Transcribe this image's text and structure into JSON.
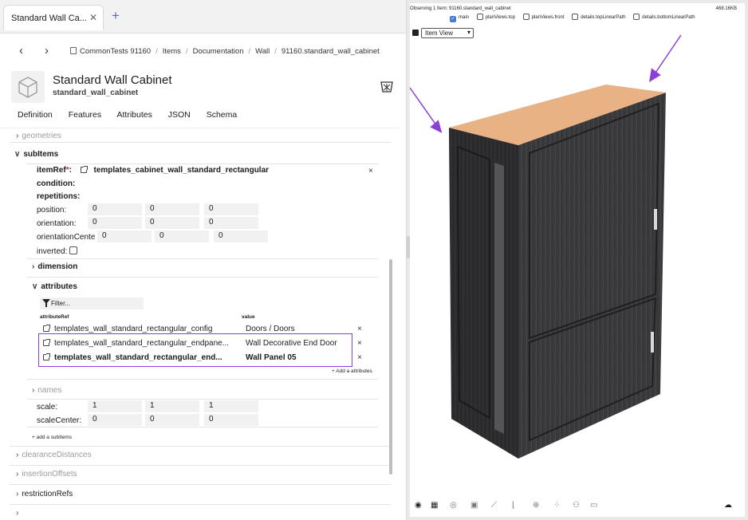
{
  "tab": {
    "title": "Standard Wall Ca...",
    "close": "✕",
    "add": "+"
  },
  "nav": {
    "back": "‹",
    "forward": "›"
  },
  "breadcrumb": [
    "CommonTests 91160",
    "Items",
    "Documentation",
    "Wall",
    "91160.standard_wall_cabinet"
  ],
  "header": {
    "title": "Standard Wall Cabinet",
    "subtitle": "standard_wall_cabinet"
  },
  "menu": [
    "Definition",
    "Features",
    "Attributes",
    "JSON",
    "Schema"
  ],
  "tree": {
    "geometries": "geometries",
    "subitems": "subItems",
    "item_ref_label": "itemRef",
    "item_ref_required": "*",
    "item_ref_colon": ":",
    "item_ref_value": "templates_cabinet_wall_standard_rectangular",
    "condition": "condition:",
    "repetitions": "repetitions:",
    "position_label": "position:",
    "position": [
      "0",
      "0",
      "0"
    ],
    "orientation_label": "orientation:",
    "orientation": [
      "0",
      "0",
      "0"
    ],
    "orientation_center_label": "orientationCente",
    "orientation_center": [
      "0",
      "0",
      "0"
    ],
    "inverted_label": "inverted:",
    "dimension": "dimension",
    "attributes": "attributes",
    "filter_placeholder": "Filter...",
    "col_attribute_ref": "attributeRef",
    "col_value": "value",
    "attribute_rows": [
      {
        "ref": "templates_wall_standard_rectangular_config",
        "value": "Doors / Doors"
      },
      {
        "ref": "templates_wall_standard_rectangular_endpane...",
        "value": "Wall Decorative End Door"
      },
      {
        "ref": "templates_wall_standard_rectangular_end...",
        "value": "Wall Panel 05"
      }
    ],
    "add_attributes": "+ Add a attributes",
    "names": "names",
    "scale_label": "scale:",
    "scale": [
      "1",
      "1",
      "1"
    ],
    "scale_center_label": "scaleCenter:",
    "scale_center": [
      "0",
      "0",
      "0"
    ],
    "add_subitems": "+ add a subItems",
    "clearance_distances": "clearanceDistances",
    "insertion_offsets": "insertionOffsets",
    "restriction_refs": "restrictionRefs",
    "row_close": "×"
  },
  "viewer": {
    "status": "Observing 1 Item: 91160.standard_wall_cabinet",
    "size": "468.16KB",
    "checkboxes": [
      {
        "label": "main",
        "checked": true,
        "mark": "✓"
      },
      {
        "label": "planViews.top",
        "checked": false,
        "mark": ""
      },
      {
        "label": "planViews.front",
        "checked": false,
        "mark": ""
      },
      {
        "label": "details.topLinearPath",
        "checked": false,
        "mark": ""
      },
      {
        "label": "details.bottomLinearPath",
        "checked": false,
        "mark": ""
      }
    ],
    "view_select": "Item View",
    "toolbar_icons": [
      "palette-icon",
      "grid-icon",
      "compass-icon",
      "cube-icon",
      "brush-icon",
      "corner-icon",
      "target-icon",
      "dots-grid-icon",
      "hierarchy-icon",
      "image-icon",
      "cloud-download-icon"
    ],
    "accent": "#8a3fd6"
  }
}
